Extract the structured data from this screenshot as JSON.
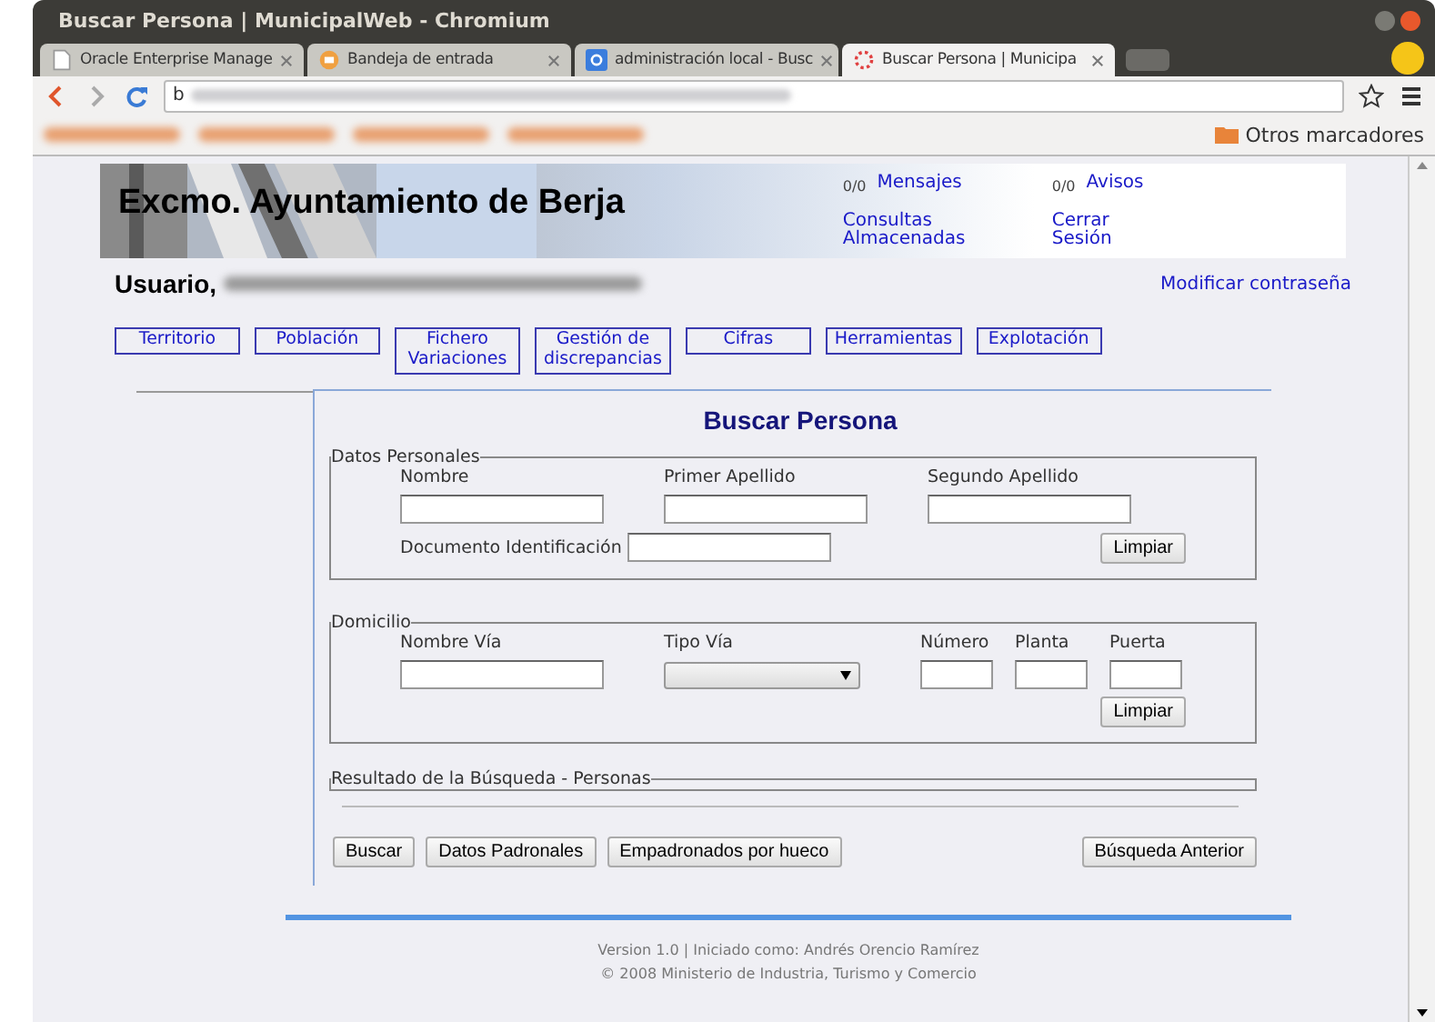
{
  "window": {
    "title": "Buscar Persona | MunicipalWeb - Chromium"
  },
  "tabs": [
    {
      "label": "Oracle Enterprise Manage",
      "kind": "page",
      "selected": false
    },
    {
      "label": "Bandeja de entrada",
      "kind": "mail",
      "selected": false
    },
    {
      "label": "administración local - Busc",
      "kind": "search",
      "selected": false
    },
    {
      "label": "Buscar Persona | Municipa",
      "kind": "loading",
      "selected": true
    }
  ],
  "address_bar": {
    "value": "b"
  },
  "bookmarks": {
    "other": "Otros marcadores"
  },
  "header": {
    "title": "Excmo. Ayuntamiento de Berja",
    "links": [
      {
        "count": "0/0",
        "label": "Mensajes"
      },
      {
        "count": "0/0",
        "label": "Avisos"
      },
      {
        "label": "Consultas\nAlmacenadas"
      },
      {
        "label": "Cerrar\nSesión"
      }
    ]
  },
  "user": {
    "label": "Usuario,",
    "change_password": "Modificar contraseña"
  },
  "nav": [
    "Territorio",
    "Población",
    "Fichero\nVariaciones",
    "Gestión de\ndiscrepancias",
    "Cifras",
    "Herramientas",
    "Explotación"
  ],
  "form": {
    "title": "Buscar Persona",
    "personal": {
      "legend": "Datos Personales",
      "fields": [
        "Nombre",
        "Primer Apellido",
        "Segundo Apellido"
      ],
      "document": "Documento Identificación",
      "clear": "Limpiar"
    },
    "address": {
      "legend": "Domicilio",
      "street": "Nombre Vía",
      "type": "Tipo Vía",
      "small_fields": [
        "Número",
        "Planta",
        "Puerta"
      ],
      "clear": "Limpiar"
    },
    "results": {
      "legend": "Resultado de la Búsqueda - Personas"
    },
    "buttons": [
      "Buscar",
      "Datos Padronales",
      "Empadronados por hueco"
    ],
    "back": "Búsqueda Anterior"
  },
  "footer": [
    "Version 1.0 | Iniciado como: Andrés Orencio Ramírez",
    "© 2008 Ministerio de Industria, Turismo y Comercio"
  ]
}
